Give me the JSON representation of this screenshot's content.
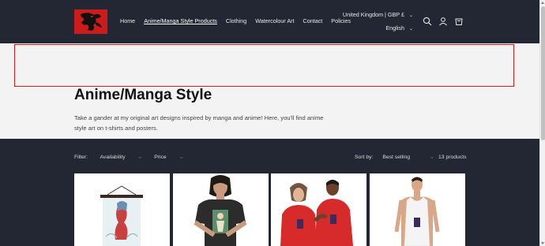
{
  "header": {
    "logo_icon": "dragon-silhouette-logo",
    "nav": [
      {
        "label": "Home",
        "active": false
      },
      {
        "label": "Anime/Manga Style Products",
        "active": true
      },
      {
        "label": "Clothing",
        "active": false
      },
      {
        "label": "Watercolour Art",
        "active": false
      },
      {
        "label": "Contact",
        "active": false
      },
      {
        "label": "Policies",
        "active": false
      }
    ],
    "country_selector": "United Kingdom | GBP £",
    "language_selector": "English",
    "icons": [
      "search-icon",
      "account-icon",
      "cart-icon"
    ]
  },
  "collection": {
    "title": "Anime/Manga Style",
    "description": "Take a gander at my original art designs inspired by manga and anime! Here, you'll find anime style art on t-shirts and posters."
  },
  "toolbar": {
    "filter_label": "Filter:",
    "availability_label": "Availability",
    "price_label": "Price",
    "sort_label": "Sort by:",
    "sort_value": "Best selling",
    "product_count": "13 products"
  },
  "colors": {
    "header_bg": "#232733",
    "page_bg": "#f3f3f3",
    "banner_outline": "#d11a1a",
    "logo_bg": "#cc1b1b"
  }
}
